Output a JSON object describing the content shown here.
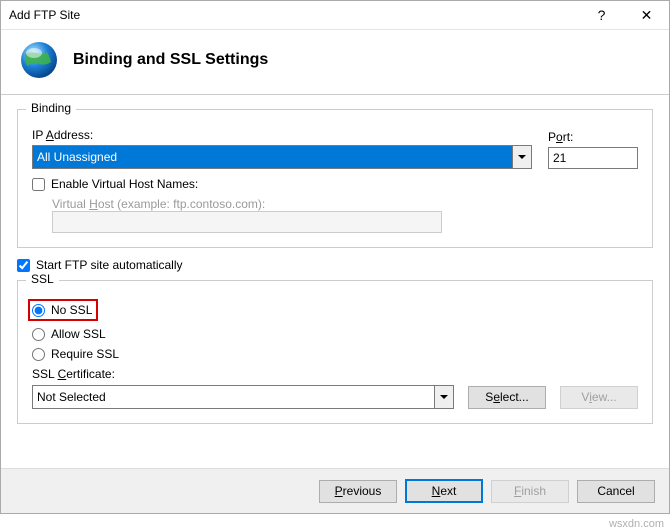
{
  "titlebar": {
    "title": "Add FTP Site"
  },
  "header": {
    "heading": "Binding and SSL Settings"
  },
  "binding": {
    "legend": "Binding",
    "ip_label_pre": "IP ",
    "ip_label_ul": "A",
    "ip_label_post": "ddress:",
    "ip_value": "All Unassigned",
    "port_label_pre": "P",
    "port_label_ul": "o",
    "port_label_post": "rt:",
    "port_value": "21",
    "enable_vh_pre": "Enable ",
    "enable_vh_ul": "V",
    "enable_vh_post": "irtual Host Names:",
    "enable_vh_checked": false,
    "vh_label_pre": "Virtual ",
    "vh_label_ul": "H",
    "vh_label_post": "ost (example: ftp.contoso.com):",
    "vh_value": ""
  },
  "start_auto": {
    "label_pre": "Start FTP site auto",
    "label_ul": "m",
    "label_post": "atically",
    "checked": true
  },
  "ssl": {
    "legend": "SSL",
    "no_ssl_pre": "",
    "no_ssl_ul": "N",
    "no_ssl_post": "o SSL",
    "allow_ssl_pre": "Allo",
    "allow_ssl_ul": "w",
    "allow_ssl_post": " SSL",
    "require_ssl_pre": "",
    "require_ssl_ul": "R",
    "require_ssl_post": "equire SSL",
    "selected": "no",
    "cert_label_pre": "SSL ",
    "cert_label_ul": "C",
    "cert_label_post": "ertificate:",
    "cert_value": "Not Selected",
    "select_btn_pre": "S",
    "select_btn_ul": "e",
    "select_btn_post": "lect...",
    "view_btn_pre": "V",
    "view_btn_ul": "i",
    "view_btn_post": "ew..."
  },
  "footer": {
    "previous_pre": "",
    "previous_ul": "P",
    "previous_post": "revious",
    "next_pre": "",
    "next_ul": "N",
    "next_post": "ext",
    "finish_pre": "",
    "finish_ul": "F",
    "finish_post": "inish",
    "cancel": "Cancel"
  },
  "watermark": "wsxdn.com"
}
